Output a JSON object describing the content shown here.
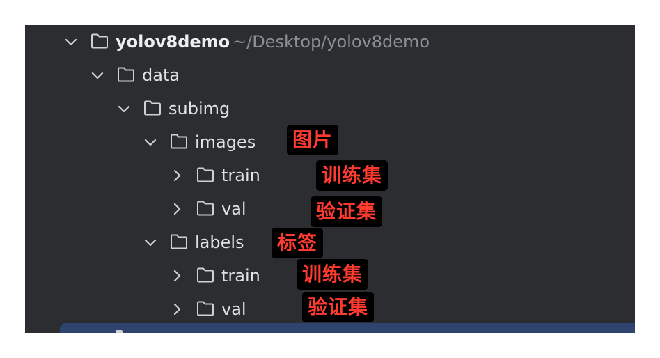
{
  "tree": {
    "root": {
      "name": "yolov8demo",
      "path": "~/Desktop/yolov8demo",
      "expanded": true
    },
    "items": [
      {
        "name": "data",
        "expanded": true
      },
      {
        "name": "subimg",
        "expanded": true
      },
      {
        "name": "images",
        "expanded": true,
        "annotation": "图片"
      },
      {
        "name": "train",
        "expanded": false,
        "annotation": "训练集"
      },
      {
        "name": "val",
        "expanded": false,
        "annotation": "验证集"
      },
      {
        "name": "labels",
        "expanded": true,
        "annotation": "标签"
      },
      {
        "name": "train",
        "expanded": false,
        "annotation": "训练集"
      },
      {
        "name": "val",
        "expanded": false,
        "annotation": "验证集"
      }
    ]
  },
  "icons": {
    "expanded": "chevron-down-icon",
    "collapsed": "chevron-right-icon",
    "folder": "folder-icon"
  },
  "colors": {
    "panel_bg": "#2b2d30",
    "text": "#dfe1e5",
    "path_text": "#8c8f95",
    "annotation_text": "#ff3b30",
    "annotation_bg": "#000000",
    "selection": "#2e436e"
  }
}
